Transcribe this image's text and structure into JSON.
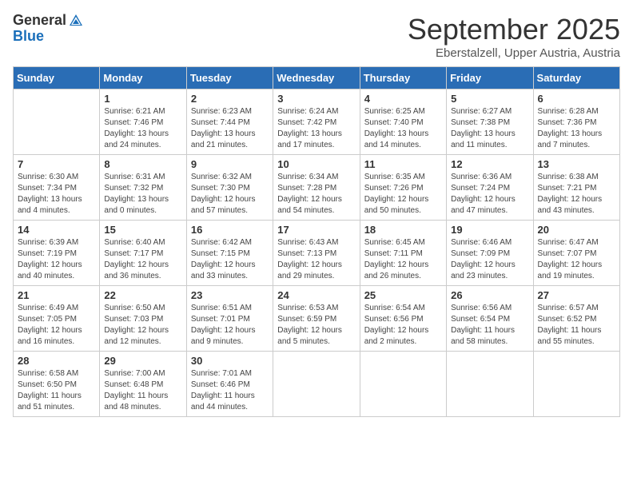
{
  "header": {
    "logo_general": "General",
    "logo_blue": "Blue",
    "month": "September 2025",
    "location": "Eberstalzell, Upper Austria, Austria"
  },
  "weekdays": [
    "Sunday",
    "Monday",
    "Tuesday",
    "Wednesday",
    "Thursday",
    "Friday",
    "Saturday"
  ],
  "weeks": [
    [
      {
        "day": "",
        "info": ""
      },
      {
        "day": "1",
        "info": "Sunrise: 6:21 AM\nSunset: 7:46 PM\nDaylight: 13 hours and 24 minutes."
      },
      {
        "day": "2",
        "info": "Sunrise: 6:23 AM\nSunset: 7:44 PM\nDaylight: 13 hours and 21 minutes."
      },
      {
        "day": "3",
        "info": "Sunrise: 6:24 AM\nSunset: 7:42 PM\nDaylight: 13 hours and 17 minutes."
      },
      {
        "day": "4",
        "info": "Sunrise: 6:25 AM\nSunset: 7:40 PM\nDaylight: 13 hours and 14 minutes."
      },
      {
        "day": "5",
        "info": "Sunrise: 6:27 AM\nSunset: 7:38 PM\nDaylight: 13 hours and 11 minutes."
      },
      {
        "day": "6",
        "info": "Sunrise: 6:28 AM\nSunset: 7:36 PM\nDaylight: 13 hours and 7 minutes."
      }
    ],
    [
      {
        "day": "7",
        "info": "Sunrise: 6:30 AM\nSunset: 7:34 PM\nDaylight: 13 hours and 4 minutes."
      },
      {
        "day": "8",
        "info": "Sunrise: 6:31 AM\nSunset: 7:32 PM\nDaylight: 13 hours and 0 minutes."
      },
      {
        "day": "9",
        "info": "Sunrise: 6:32 AM\nSunset: 7:30 PM\nDaylight: 12 hours and 57 minutes."
      },
      {
        "day": "10",
        "info": "Sunrise: 6:34 AM\nSunset: 7:28 PM\nDaylight: 12 hours and 54 minutes."
      },
      {
        "day": "11",
        "info": "Sunrise: 6:35 AM\nSunset: 7:26 PM\nDaylight: 12 hours and 50 minutes."
      },
      {
        "day": "12",
        "info": "Sunrise: 6:36 AM\nSunset: 7:24 PM\nDaylight: 12 hours and 47 minutes."
      },
      {
        "day": "13",
        "info": "Sunrise: 6:38 AM\nSunset: 7:21 PM\nDaylight: 12 hours and 43 minutes."
      }
    ],
    [
      {
        "day": "14",
        "info": "Sunrise: 6:39 AM\nSunset: 7:19 PM\nDaylight: 12 hours and 40 minutes."
      },
      {
        "day": "15",
        "info": "Sunrise: 6:40 AM\nSunset: 7:17 PM\nDaylight: 12 hours and 36 minutes."
      },
      {
        "day": "16",
        "info": "Sunrise: 6:42 AM\nSunset: 7:15 PM\nDaylight: 12 hours and 33 minutes."
      },
      {
        "day": "17",
        "info": "Sunrise: 6:43 AM\nSunset: 7:13 PM\nDaylight: 12 hours and 29 minutes."
      },
      {
        "day": "18",
        "info": "Sunrise: 6:45 AM\nSunset: 7:11 PM\nDaylight: 12 hours and 26 minutes."
      },
      {
        "day": "19",
        "info": "Sunrise: 6:46 AM\nSunset: 7:09 PM\nDaylight: 12 hours and 23 minutes."
      },
      {
        "day": "20",
        "info": "Sunrise: 6:47 AM\nSunset: 7:07 PM\nDaylight: 12 hours and 19 minutes."
      }
    ],
    [
      {
        "day": "21",
        "info": "Sunrise: 6:49 AM\nSunset: 7:05 PM\nDaylight: 12 hours and 16 minutes."
      },
      {
        "day": "22",
        "info": "Sunrise: 6:50 AM\nSunset: 7:03 PM\nDaylight: 12 hours and 12 minutes."
      },
      {
        "day": "23",
        "info": "Sunrise: 6:51 AM\nSunset: 7:01 PM\nDaylight: 12 hours and 9 minutes."
      },
      {
        "day": "24",
        "info": "Sunrise: 6:53 AM\nSunset: 6:59 PM\nDaylight: 12 hours and 5 minutes."
      },
      {
        "day": "25",
        "info": "Sunrise: 6:54 AM\nSunset: 6:56 PM\nDaylight: 12 hours and 2 minutes."
      },
      {
        "day": "26",
        "info": "Sunrise: 6:56 AM\nSunset: 6:54 PM\nDaylight: 11 hours and 58 minutes."
      },
      {
        "day": "27",
        "info": "Sunrise: 6:57 AM\nSunset: 6:52 PM\nDaylight: 11 hours and 55 minutes."
      }
    ],
    [
      {
        "day": "28",
        "info": "Sunrise: 6:58 AM\nSunset: 6:50 PM\nDaylight: 11 hours and 51 minutes."
      },
      {
        "day": "29",
        "info": "Sunrise: 7:00 AM\nSunset: 6:48 PM\nDaylight: 11 hours and 48 minutes."
      },
      {
        "day": "30",
        "info": "Sunrise: 7:01 AM\nSunset: 6:46 PM\nDaylight: 11 hours and 44 minutes."
      },
      {
        "day": "",
        "info": ""
      },
      {
        "day": "",
        "info": ""
      },
      {
        "day": "",
        "info": ""
      },
      {
        "day": "",
        "info": ""
      }
    ]
  ]
}
